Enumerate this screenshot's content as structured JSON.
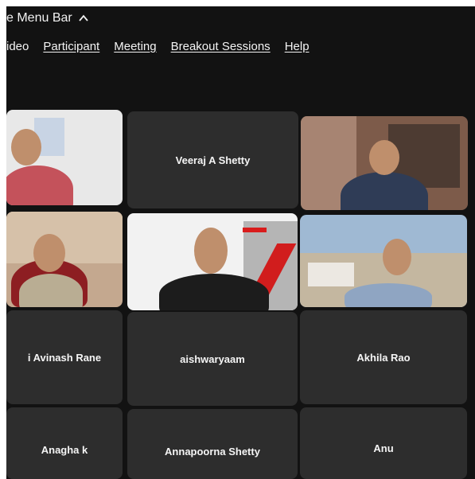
{
  "window": {
    "menu_toggle_label": "e Menu Bar"
  },
  "menu": [
    "ideo",
    "Participant",
    "Meeting",
    "Breakout Sessions",
    "Help"
  ],
  "participants": {
    "p1": "",
    "p2": "Veeraj A Shetty",
    "p3": "",
    "p4": "",
    "p5": "",
    "p6": "",
    "p7": "i Avinash Rane",
    "p8": "aishwaryaam",
    "p9": "Akhila Rao",
    "p10": "Anagha k",
    "p11": "Annapoorna Shetty",
    "p12": "Anu"
  },
  "colors": {
    "background": "#121212",
    "tile": "#2d2d2d",
    "text": "#f5f5f5"
  }
}
